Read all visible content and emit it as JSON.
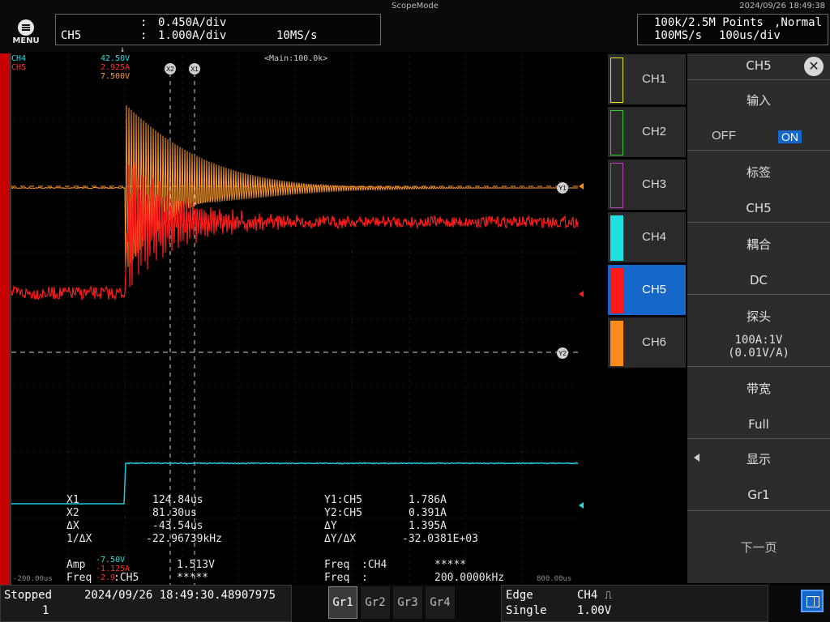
{
  "top": {
    "app_title": "ScopeMode",
    "datetime": "2024/09/26 18:49:38",
    "menu_label": "MENU",
    "scale": {
      "channel": "CH5",
      "colon1": ":",
      "colon2": ":",
      "v_per_div": "0.450A/div",
      "a_per_div": "1.000A/div",
      "sample": "10MS/s"
    },
    "acq": {
      "points": "100k/2.5M Points",
      "mode": ",Normal",
      "rate": "100MS/s",
      "timebase": "100us/div"
    }
  },
  "plot": {
    "ch4_label": "CH4",
    "ch5_label": "CH5",
    "ch4_val": "42.50V",
    "ch5_val": "2.925A",
    "extra_val": "7.500V",
    "main_zoom": "<Main:100.0k>",
    "trig_marker": "T",
    "x2_marker": "X2",
    "x1_marker": "X1",
    "y1_marker": "Y1",
    "y2_marker": "Y2",
    "t_left": "-200.00us",
    "t_right": "800.00us"
  },
  "measurements": {
    "x1_label": "X1",
    "x1_val": "124.84us",
    "x2_label": "X2",
    "x2_val": "81.30us",
    "dx_label": "ΔX",
    "dx_val": "-43.54us",
    "inv_dx_label": "1/ΔX",
    "inv_dx_val": "-22.96739kHz",
    "y1_label": "Y1:CH5",
    "y1_val": "1.786A",
    "y2_label": "Y2:CH5",
    "y2_val": "0.391A",
    "dy_label": "ΔY",
    "dy_val": "1.395A",
    "dydx_label": "ΔY/ΔX",
    "dydx_val": "-32.0381E+03",
    "amp_label": "Amp",
    "amp_src": ":CH4",
    "amp_val": "1.513V",
    "freq1_label": "Freq",
    "freq1_src": ":CH5",
    "freq1_val": "*****",
    "freq2_label": "Freq",
    "freq2_src": ":CH4",
    "freq2_val": "*****",
    "freq3_label": "Freq",
    "freq3_src": ":",
    "freq3_val": "200.0000kHz",
    "side_a": "-7.50V",
    "side_b": "-1.125A",
    "side_c": "-2.9"
  },
  "channels": [
    {
      "label": "CH1",
      "color": "#e6e62a"
    },
    {
      "label": "CH2",
      "color": "#33cc33"
    },
    {
      "label": "CH3",
      "color": "#c040c0"
    },
    {
      "label": "CH4",
      "color": "#20e0e0"
    },
    {
      "label": "CH5",
      "color": "#ff1a1a"
    },
    {
      "label": "CH6",
      "color": "#ff8c1a"
    }
  ],
  "panel": {
    "title": "CH5",
    "input_title": "输入",
    "off": "OFF",
    "on": "ON",
    "label_title": "标签",
    "label_val": "CH5",
    "coupling_title": "耦合",
    "coupling_val": "DC",
    "probe_title": "探头",
    "probe_val1": "100A:1V",
    "probe_val2": "(0.01V/A)",
    "bw_title": "带宽",
    "bw_val": "Full",
    "display_title": "显示",
    "display_val": "Gr1",
    "next_page": "下一页"
  },
  "bottom": {
    "status": "Stopped",
    "count": "1",
    "timestamp": "2024/09/26 18:49:30.48907975",
    "groups": [
      "Gr1",
      "Gr2",
      "Gr3",
      "Gr4"
    ],
    "trig_type": "Edge",
    "trig_src": "CH4",
    "trig_mode": "Single",
    "trig_level": "1.00V"
  },
  "colors": {
    "ch4": "#20e0e0",
    "ch5": "#ff1a1a",
    "ch6": "#ff8c1a",
    "accent": "#1466c8"
  }
}
